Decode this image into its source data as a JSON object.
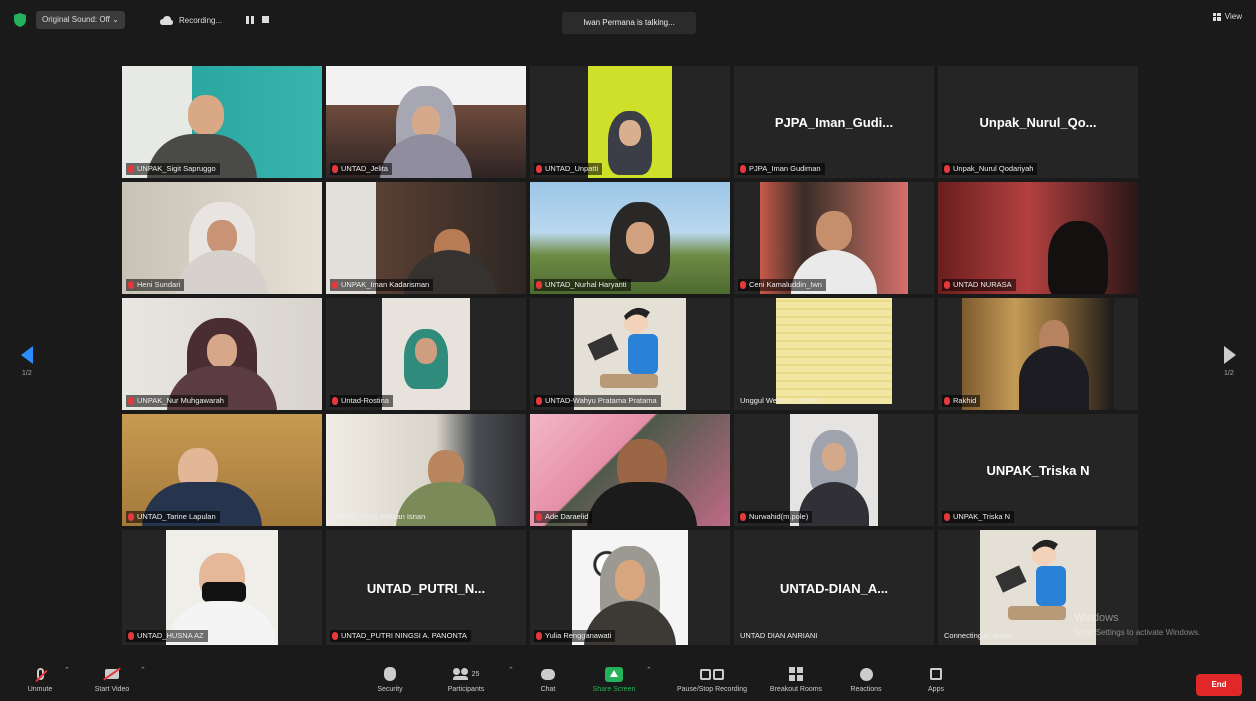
{
  "topbar": {
    "original_sound": "Original Sound: Off",
    "recording": "Recording...",
    "talking": "Iwan Permana is talking...",
    "view": "View"
  },
  "grid": {
    "prev_page": "1/2",
    "next_page": "1/2"
  },
  "tiles": [
    {
      "label": "UNPAK_Sigit Sapruggo",
      "muted": true
    },
    {
      "label": "UNTAD_Jelita",
      "muted": true
    },
    {
      "label": "UNTAD_Unpatti",
      "muted": true
    },
    {
      "label": "PJPA_Iman Gudiman",
      "muted": true,
      "name_text": "PJPA_Iman_Gudi..."
    },
    {
      "label": "Unpak_Nurul Qodariyah",
      "muted": true,
      "name_text": "Unpak_Nurul_Qo..."
    },
    {
      "label": "Heni Sundari",
      "muted": true
    },
    {
      "label": "UNPAK_Iman Kadarisman",
      "muted": true
    },
    {
      "label": "UNTAD_Nurhal Haryanti",
      "muted": true
    },
    {
      "label": "Ceni Kamaluddin_Iwn",
      "muted": true
    },
    {
      "label": "UNTAD NURASA",
      "muted": true
    },
    {
      "label": "UNPAK_Nur Muhgawarah",
      "muted": true
    },
    {
      "label": "Untad-Rostina",
      "muted": true
    },
    {
      "label": "UNTAD-Wahyu Pratama Pratama",
      "muted": true
    },
    {
      "label": "Unggul Website UNTAD",
      "muted": false
    },
    {
      "label": "Rakhid",
      "muted": true
    },
    {
      "label": "UNTAD_Tarine Lapulan",
      "muted": true
    },
    {
      "label": "UNPAK_Iding Ridwan Isnan",
      "muted": false
    },
    {
      "label": "Ade Daraelid",
      "muted": true
    },
    {
      "label": "Nurwahid(m.pole)",
      "muted": true
    },
    {
      "label": "UNPAK_Triska N",
      "muted": true,
      "name_text": "UNPAK_Triska N"
    },
    {
      "label": "UNTAD_HUSNA AZ",
      "muted": true
    },
    {
      "label": "UNTAD_PUTRI NINGSI A. PANONTA",
      "muted": true,
      "name_text": "UNTAD_PUTRI_N..."
    },
    {
      "label": "Yulia Rengganawati",
      "muted": true
    },
    {
      "label": "UNTAD DIAN ANRIANI",
      "muted": false,
      "name_text": "UNTAD-DIAN_A..."
    },
    {
      "label": "Connecting to Audio...",
      "muted": false
    }
  ],
  "watermark": {
    "title": "Windows",
    "subtitle": "Go to Settings to activate Windows."
  },
  "toolbar": {
    "unmute": "Unmute",
    "start_video": "Start Video",
    "security": "Security",
    "participants": "Participants",
    "participant_count": "25",
    "chat": "Chat",
    "share_screen": "Share Screen",
    "pause_stop_recording": "Pause/Stop Recording",
    "breakout_rooms": "Breakout Rooms",
    "reactions": "Reactions",
    "apps": "Apps",
    "end": "End"
  },
  "colors": {
    "background": "#1a1a1a",
    "tile": "#252525",
    "share_green": "#24b35a",
    "end_red": "#e02828",
    "accent_blue": "#2d8cff"
  }
}
